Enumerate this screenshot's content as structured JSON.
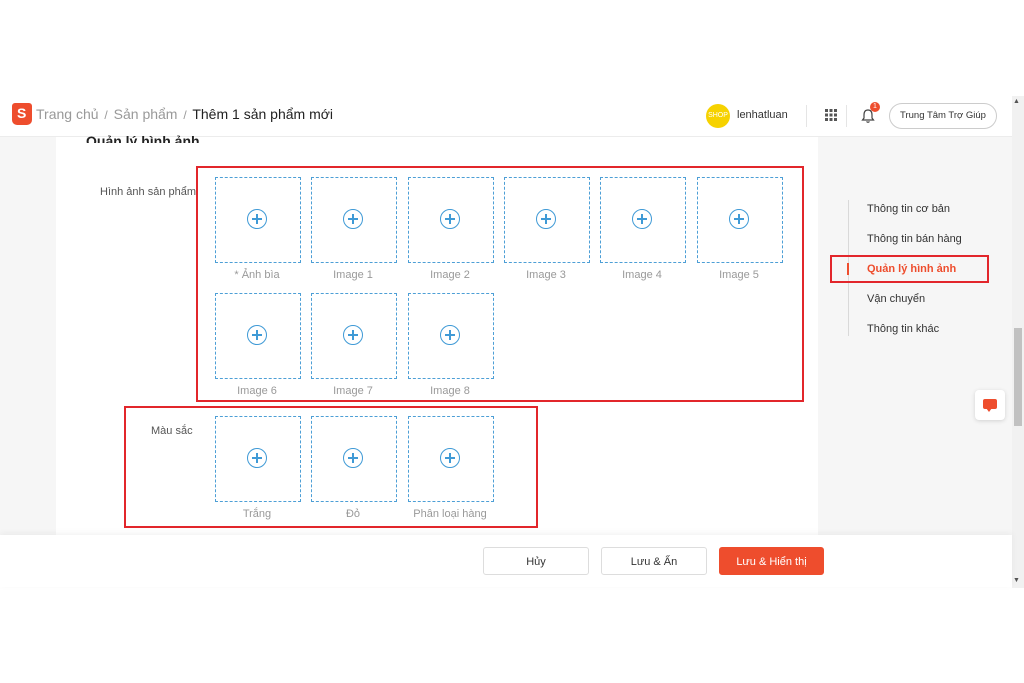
{
  "header": {
    "logo_letter": "S",
    "breadcrumb": [
      "Trang chủ",
      "Sản phẩm"
    ],
    "breadcrumb_current": "Thêm 1 sản phẩm mới",
    "breadcrumb_separator": "/",
    "avatar_text": "SHOP",
    "username": "lenhatluan",
    "notification_count": "1",
    "help_button": "Trung Tâm Trợ Giúp"
  },
  "main": {
    "section_title": "Quản lý hình ảnh",
    "product_images_label": "Hình ảnh sản phẩm",
    "product_images": [
      "* Ảnh bìa",
      "Image 1",
      "Image 2",
      "Image 3",
      "Image 4",
      "Image 5",
      "Image 6",
      "Image 7",
      "Image 8"
    ],
    "color_label": "Màu sắc",
    "color_images": [
      "Trắng",
      "Đỏ",
      "Phân loại hàng"
    ]
  },
  "side_nav": {
    "items": [
      "Thông tin cơ bản",
      "Thông tin bán hàng",
      "Quản lý hình ảnh",
      "Vận chuyển",
      "Thông tin khác"
    ],
    "active_index": 2
  },
  "footer": {
    "cancel": "Hủy",
    "save_hide": "Lưu & Ẩn",
    "save_show": "Lưu & Hiển thị"
  },
  "colors": {
    "accent": "#ee4d2d",
    "highlight_box": "#e2262b",
    "upload_border": "#4d9fd6"
  }
}
